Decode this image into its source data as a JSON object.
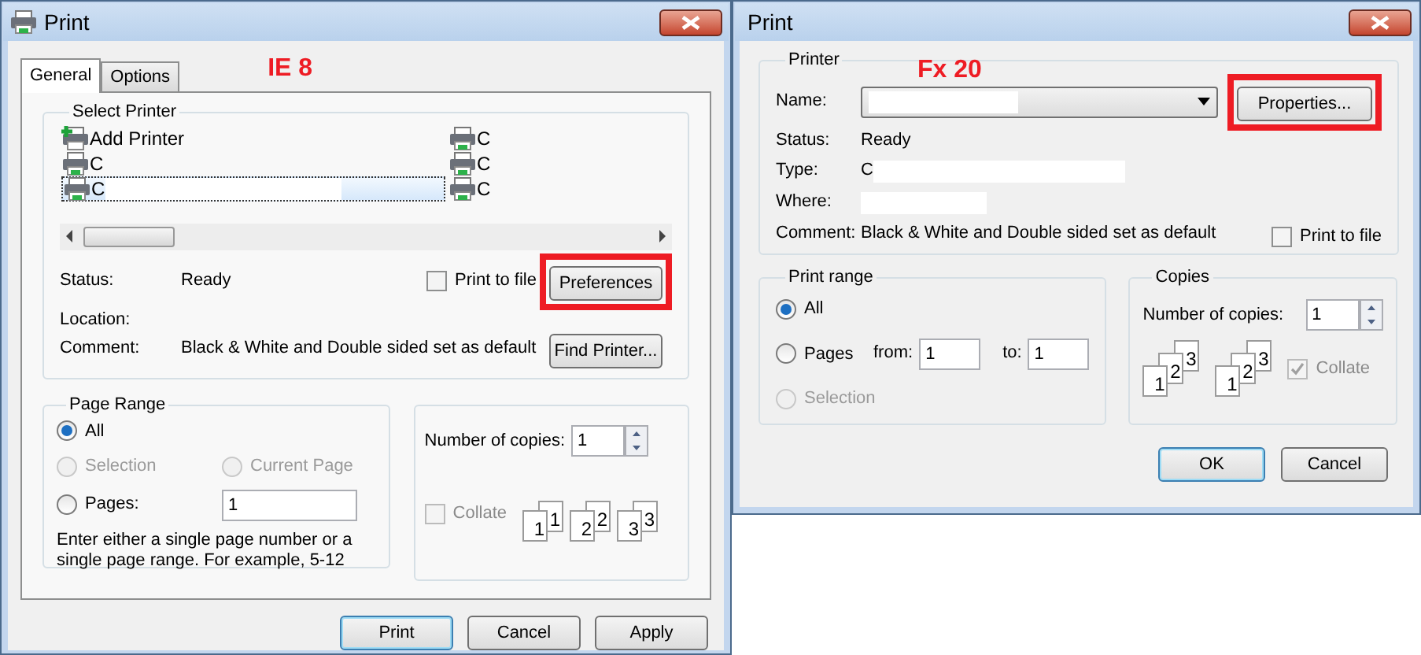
{
  "ie_dialog": {
    "title": "Print",
    "annotation": "IE 8",
    "tabs": [
      {
        "label": "General",
        "selected": true
      },
      {
        "label": "Options",
        "selected": false
      }
    ],
    "select_printer": {
      "legend": "Select Printer",
      "printers": [
        {
          "label": "Add Printer",
          "kind": "add",
          "selected": false
        },
        {
          "label": "C",
          "kind": "printer",
          "selected": false
        },
        {
          "label": "C",
          "kind": "printer",
          "selected": true
        },
        {
          "label": "C",
          "kind": "printer",
          "selected": false
        },
        {
          "label": "C",
          "kind": "printer",
          "selected": false
        },
        {
          "label": "C",
          "kind": "printer",
          "selected": false
        }
      ]
    },
    "details": [
      {
        "label": "Status:",
        "value": "Ready"
      },
      {
        "label": "Location:"
      },
      {
        "label": "Comment:",
        "value": "Black & White and Double sided set as default"
      }
    ],
    "print_to_file": {
      "label": "Print to file",
      "checked": false
    },
    "preferences_button": {
      "label": "Preferences",
      "highlighted": true
    },
    "find_printer_button": {
      "label": "Find Printer..."
    },
    "page_range": {
      "legend": "Page Range",
      "options": [
        {
          "label": "All",
          "selected": true,
          "disabled": false
        },
        {
          "label": "Selection",
          "selected": false,
          "disabled": true
        },
        {
          "label": "Current Page",
          "selected": false,
          "disabled": true
        },
        {
          "label": "Pages:",
          "selected": false,
          "disabled": false
        }
      ],
      "pages_value": "1",
      "hint": "Enter either a single page number or a single page range.  For example, 5-12"
    },
    "copies": {
      "label": "Number of copies:",
      "value": "1"
    },
    "collate": {
      "label": "Collate",
      "checked": false,
      "disabled": true
    },
    "collate_stacks": [
      [
        "1",
        "1"
      ],
      [
        "2",
        "2"
      ],
      [
        "3",
        "3"
      ]
    ],
    "buttons": [
      {
        "label": "Print",
        "default": true
      },
      {
        "label": "Cancel",
        "default": false
      },
      {
        "label": "Apply",
        "default": false
      }
    ]
  },
  "fx_dialog": {
    "title": "Print",
    "annotation": "Fx 20",
    "printer": {
      "legend": "Printer",
      "name_label": "Name:",
      "properties_button": {
        "label": "Properties...",
        "highlighted": true
      },
      "details": [
        {
          "label": "Status:",
          "value": "Ready"
        },
        {
          "label": "Type:",
          "value": "C"
        },
        {
          "label": "Where:"
        },
        {
          "label": "Comment:",
          "value": "Black & White and Double sided set as default"
        }
      ],
      "print_to_file": {
        "label": "Print to file",
        "checked": false
      }
    },
    "print_range": {
      "legend": "Print range",
      "options": [
        {
          "label": "All",
          "selected": true,
          "disabled": false
        },
        {
          "label": "Pages",
          "selected": false,
          "disabled": false
        },
        {
          "label": "Selection",
          "selected": false,
          "disabled": true
        }
      ],
      "from_label": "from:",
      "from_value": "1",
      "to_label": "to:",
      "to_value": "1"
    },
    "copies": {
      "legend": "Copies",
      "label": "Number of copies:",
      "value": "1"
    },
    "collate_stacks": [
      [
        "1",
        "2",
        "3"
      ],
      [
        "1",
        "2",
        "3"
      ]
    ],
    "collate": {
      "label": "Collate",
      "checked": true,
      "disabled": true
    },
    "buttons": [
      {
        "label": "OK",
        "default": true
      },
      {
        "label": "Cancel",
        "default": false
      }
    ]
  }
}
